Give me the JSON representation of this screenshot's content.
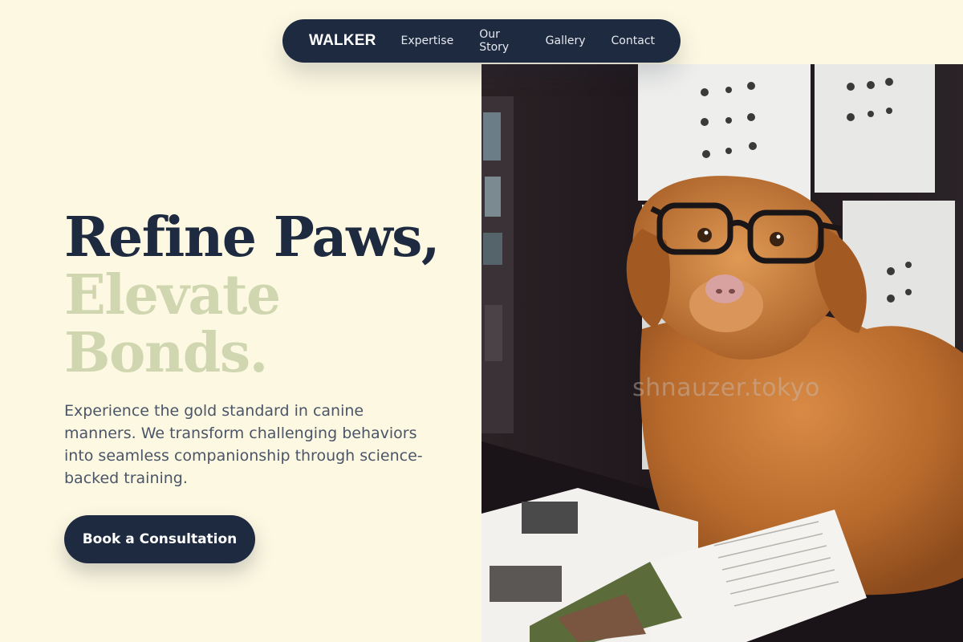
{
  "nav": {
    "brand": "WALKER",
    "links": [
      "Expertise",
      "Our Story",
      "Gallery",
      "Contact"
    ]
  },
  "hero": {
    "headline_line1": "Refine Paws,",
    "headline_line2": "Elevate",
    "headline_line3": "Bonds.",
    "description": "Experience the gold standard in canine manners. We transform challenging behaviors into seamless companionship through science-backed training.",
    "cta_label": "Book a Consultation"
  },
  "photo": {
    "watermark": "shnauzer.tokyo",
    "alt": "Dog wearing glasses reading a magazine"
  },
  "colors": {
    "background": "#fdf8e1",
    "navy": "#1e2a40",
    "sage": "#d0d7b0",
    "body_text": "#4a5568"
  }
}
